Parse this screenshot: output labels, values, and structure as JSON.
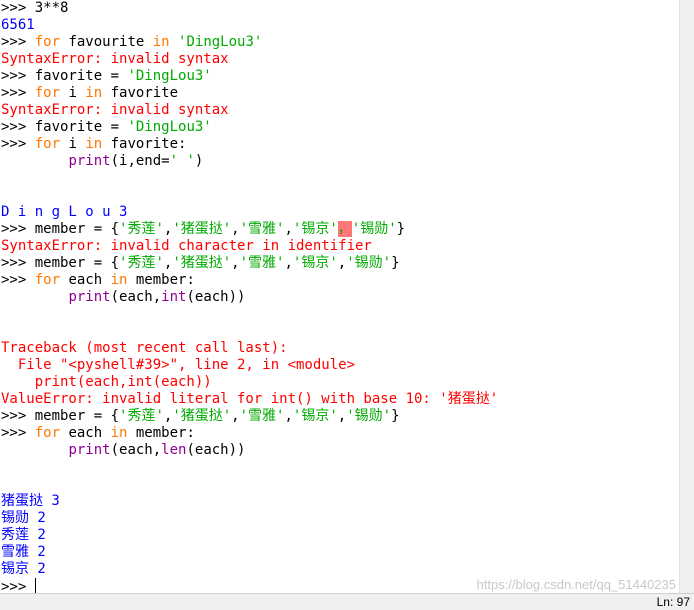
{
  "lines": [
    [
      {
        "t": ">>> ",
        "c": "prompt"
      },
      {
        "t": "3**8",
        "c": "plain"
      }
    ],
    [
      {
        "t": "6561",
        "c": "out"
      }
    ],
    [
      {
        "t": ">>> ",
        "c": "prompt"
      },
      {
        "t": "for",
        "c": "kw"
      },
      {
        "t": " favourite ",
        "c": "plain"
      },
      {
        "t": "in",
        "c": "kw"
      },
      {
        "t": " ",
        "c": "plain"
      },
      {
        "t": "'DingLou3'",
        "c": "str"
      }
    ],
    [
      {
        "t": "SyntaxError: invalid syntax",
        "c": "err"
      }
    ],
    [
      {
        "t": ">>> ",
        "c": "prompt"
      },
      {
        "t": "favorite = ",
        "c": "plain"
      },
      {
        "t": "'DingLou3'",
        "c": "str"
      }
    ],
    [
      {
        "t": ">>> ",
        "c": "prompt"
      },
      {
        "t": "for",
        "c": "kw"
      },
      {
        "t": " i ",
        "c": "plain"
      },
      {
        "t": "in",
        "c": "kw"
      },
      {
        "t": " favorite",
        "c": "plain"
      }
    ],
    [
      {
        "t": "SyntaxError: invalid syntax",
        "c": "err"
      }
    ],
    [
      {
        "t": ">>> ",
        "c": "prompt"
      },
      {
        "t": "favorite = ",
        "c": "plain"
      },
      {
        "t": "'DingLou3'",
        "c": "str"
      }
    ],
    [
      {
        "t": ">>> ",
        "c": "prompt"
      },
      {
        "t": "for",
        "c": "kw"
      },
      {
        "t": " i ",
        "c": "plain"
      },
      {
        "t": "in",
        "c": "kw"
      },
      {
        "t": " favorite:",
        "c": "plain"
      }
    ],
    [
      {
        "t": "        ",
        "c": "plain"
      },
      {
        "t": "print",
        "c": "bi"
      },
      {
        "t": "(i,end=",
        "c": "plain"
      },
      {
        "t": "' '",
        "c": "str"
      },
      {
        "t": ")",
        "c": "plain"
      }
    ],
    [],
    [],
    [
      {
        "t": "D i n g L o u 3",
        "c": "out"
      }
    ],
    [
      {
        "t": ">>> ",
        "c": "prompt"
      },
      {
        "t": "member = {",
        "c": "plain"
      },
      {
        "t": "'秀莲'",
        "c": "str"
      },
      {
        "t": ",",
        "c": "plain"
      },
      {
        "t": "'猪蛋挞'",
        "c": "str"
      },
      {
        "t": ",",
        "c": "plain"
      },
      {
        "t": "'雪雅'",
        "c": "str"
      },
      {
        "t": ",",
        "c": "plain"
      },
      {
        "t": "'锡京'",
        "c": "str"
      },
      {
        "t": "，",
        "c": "hl"
      },
      {
        "t": "'锡勋'",
        "c": "str"
      },
      {
        "t": "}",
        "c": "plain"
      }
    ],
    [
      {
        "t": "SyntaxError: invalid character in identifier",
        "c": "err"
      }
    ],
    [
      {
        "t": ">>> ",
        "c": "prompt"
      },
      {
        "t": "member = {",
        "c": "plain"
      },
      {
        "t": "'秀莲'",
        "c": "str"
      },
      {
        "t": ",",
        "c": "plain"
      },
      {
        "t": "'猪蛋挞'",
        "c": "str"
      },
      {
        "t": ",",
        "c": "plain"
      },
      {
        "t": "'雪雅'",
        "c": "str"
      },
      {
        "t": ",",
        "c": "plain"
      },
      {
        "t": "'锡京'",
        "c": "str"
      },
      {
        "t": ",",
        "c": "plain"
      },
      {
        "t": "'锡勋'",
        "c": "str"
      },
      {
        "t": "}",
        "c": "plain"
      }
    ],
    [
      {
        "t": ">>> ",
        "c": "prompt"
      },
      {
        "t": "for",
        "c": "kw"
      },
      {
        "t": " each ",
        "c": "plain"
      },
      {
        "t": "in",
        "c": "kw"
      },
      {
        "t": " member:",
        "c": "plain"
      }
    ],
    [
      {
        "t": "        ",
        "c": "plain"
      },
      {
        "t": "print",
        "c": "bi"
      },
      {
        "t": "(each,",
        "c": "plain"
      },
      {
        "t": "int",
        "c": "bi"
      },
      {
        "t": "(each))",
        "c": "plain"
      }
    ],
    [],
    [],
    [
      {
        "t": "Traceback (most recent call last):",
        "c": "err"
      }
    ],
    [
      {
        "t": "  File \"<pyshell#39>\", line 2, in <module>",
        "c": "err"
      }
    ],
    [
      {
        "t": "    print(each,int(each))",
        "c": "err"
      }
    ],
    [
      {
        "t": "ValueError: invalid literal for int() with base 10: '猪蛋挞'",
        "c": "err"
      }
    ],
    [
      {
        "t": ">>> ",
        "c": "prompt"
      },
      {
        "t": "member = {",
        "c": "plain"
      },
      {
        "t": "'秀莲'",
        "c": "str"
      },
      {
        "t": ",",
        "c": "plain"
      },
      {
        "t": "'猪蛋挞'",
        "c": "str"
      },
      {
        "t": ",",
        "c": "plain"
      },
      {
        "t": "'雪雅'",
        "c": "str"
      },
      {
        "t": ",",
        "c": "plain"
      },
      {
        "t": "'锡京'",
        "c": "str"
      },
      {
        "t": ",",
        "c": "plain"
      },
      {
        "t": "'锡勋'",
        "c": "str"
      },
      {
        "t": "}",
        "c": "plain"
      }
    ],
    [
      {
        "t": ">>> ",
        "c": "prompt"
      },
      {
        "t": "for",
        "c": "kw"
      },
      {
        "t": " each ",
        "c": "plain"
      },
      {
        "t": "in",
        "c": "kw"
      },
      {
        "t": " member:",
        "c": "plain"
      }
    ],
    [
      {
        "t": "        ",
        "c": "plain"
      },
      {
        "t": "print",
        "c": "bi"
      },
      {
        "t": "(each,",
        "c": "plain"
      },
      {
        "t": "len",
        "c": "bi"
      },
      {
        "t": "(each))",
        "c": "plain"
      }
    ],
    [],
    [],
    [
      {
        "t": "猪蛋挞 3",
        "c": "out"
      }
    ],
    [
      {
        "t": "锡勋 2",
        "c": "out"
      }
    ],
    [
      {
        "t": "秀莲 2",
        "c": "out"
      }
    ],
    [
      {
        "t": "雪雅 2",
        "c": "out"
      }
    ],
    [
      {
        "t": "锡京 2",
        "c": "out"
      }
    ],
    [
      {
        "t": ">>> ",
        "c": "prompt"
      },
      {
        "t": "",
        "c": "cursor"
      }
    ]
  ],
  "status": {
    "line_col": "Ln: 97"
  },
  "watermark": "https://blog.csdn.net/qq_51440235"
}
